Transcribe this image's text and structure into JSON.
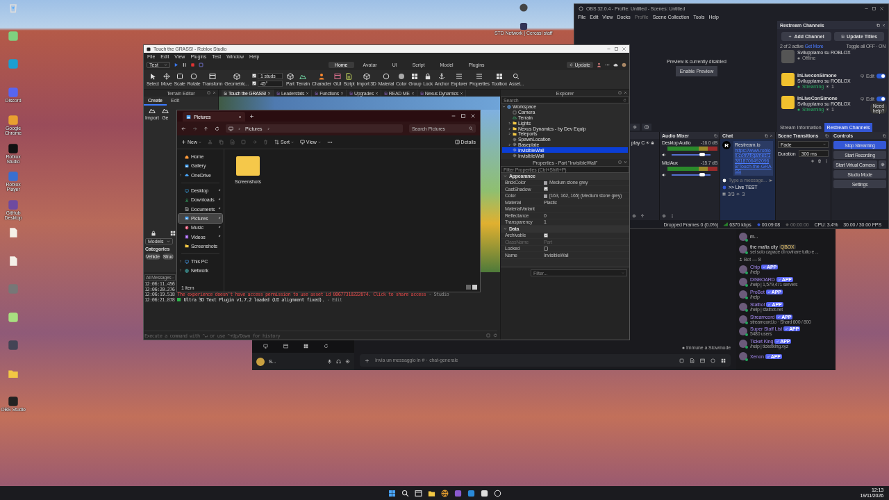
{
  "desktop": {
    "icons": [
      {
        "kind": "bin"
      },
      {
        "kind": "app"
      },
      {
        "kind": "app"
      },
      {
        "kind": "app",
        "label": "Discord"
      },
      {
        "kind": "app",
        "label": "Google Chrome"
      },
      {
        "kind": "app",
        "label": "Roblox Studio"
      },
      {
        "kind": "app",
        "label": "Roblox Player"
      },
      {
        "kind": "app",
        "label": "GitHub Desktop"
      },
      {
        "kind": "file"
      },
      {
        "kind": "file"
      },
      {
        "kind": "app"
      },
      {
        "kind": "app"
      },
      {
        "kind": "app"
      },
      {
        "kind": "folder"
      },
      {
        "kind": "app",
        "label": "OBS Studio"
      }
    ],
    "top_shortcut": {
      "label": "STD Network | Cercasi staff"
    }
  },
  "studio": {
    "title": "Touch the GRASS! - Roblox Studio",
    "menu": [
      "File",
      "Edit",
      "View",
      "Plugins",
      "Test",
      "Window",
      "Help"
    ],
    "mode": "Test",
    "ribbon_tabs": [
      {
        "label": "Home",
        "selected": true
      },
      {
        "label": "Avatar",
        "selected": false
      },
      {
        "label": "UI",
        "selected": false
      },
      {
        "label": "Script",
        "selected": false
      },
      {
        "label": "Model",
        "selected": false
      },
      {
        "label": "Plugins",
        "selected": false
      }
    ],
    "update_button": "Update",
    "tools_a": [
      "Select",
      "Move",
      "Scale",
      "Rotate",
      "Transform",
      "Geometric..."
    ],
    "snap": [
      {
        "value": "1 studs",
        "checked": true
      },
      {
        "value": "45°",
        "checked": true
      }
    ],
    "tools_b": [
      "Part",
      "Terrain",
      "Character",
      "GUI",
      "Script",
      "Import 3D",
      "Material",
      "Color",
      "Group",
      "Lock",
      "Anchor",
      "Explorer",
      "Properties",
      "Toolbox",
      "Asset..."
    ],
    "doc_tabs": [
      {
        "label": "Touch the GRASS!",
        "selected": true
      },
      {
        "label": "Leaderstats",
        "selected": false
      },
      {
        "label": "Functions",
        "selected": false
      },
      {
        "label": "Upgrades",
        "selected": false
      },
      {
        "label": "READ ME",
        "selected": false
      },
      {
        "label": "Nexus Dynamics",
        "selected": false
      }
    ],
    "terrain_editor": {
      "title": "Terrain Editor",
      "tabs": [
        {
          "label": "Create",
          "selected": true
        },
        {
          "label": "Edit",
          "selected": false
        }
      ],
      "tools": [
        "Import",
        "Ge"
      ]
    },
    "toolbox": {
      "dropdown": "Models",
      "categories_title": "Categories",
      "chips": [
        "Vehicle",
        "Struc"
      ]
    },
    "output": {
      "filter": "All Messages",
      "lines": [
        {
          "time": "12:06:11.456",
          "kind": "info"
        },
        {
          "time": "12:06:20.276",
          "kind": "info"
        },
        {
          "time": "12:06:19.518",
          "kind": "error",
          "text": "The experience doesn't have access permission to use asset id 80677318222874. Click to share access",
          "source": "-  Studio"
        },
        {
          "time": "12:06:21.878",
          "kind": "plugin",
          "text": "Ultra 3D Text Plugin v1.7.2 loaded (UI alignment fixed).",
          "source": "-  Edit"
        }
      ],
      "command_placeholder": "Execute a command with ^↵ or use ^+Up/Down for history"
    },
    "explorer": {
      "title": "Explorer",
      "search_placeholder": "Search",
      "tree": [
        {
          "label": "Workspace",
          "kind": "service",
          "expanded": true,
          "selected": false,
          "children": [
            {
              "label": "Camera",
              "kind": "camera",
              "selected": false
            },
            {
              "label": "Terrain",
              "kind": "terrain",
              "selected": false
            },
            {
              "label": "Lights",
              "kind": "folder",
              "expanded": false,
              "selected": false
            },
            {
              "label": "Nexus Dynamics - by Dev Equip",
              "kind": "folder",
              "expanded": false,
              "selected": false
            },
            {
              "label": "Teleports",
              "kind": "folder",
              "expanded": false,
              "selected": false
            },
            {
              "label": "SpawnLocation",
              "kind": "part",
              "selected": false
            },
            {
              "label": "Baseplate",
              "kind": "part",
              "expanded": false,
              "selected": false
            },
            {
              "label": "InvisibleWall",
              "kind": "part",
              "selected": true
            },
            {
              "label": "InvisibleWall",
              "kind": "part",
              "selected": false
            }
          ]
        }
      ]
    },
    "properties": {
      "title": "Properties - Part \"InvisibleWall\"",
      "filter_placeholder": "Filter Properties (Ctrl+Shift+P)",
      "sections": [
        {
          "title": "Appearance",
          "rows": [
            {
              "name": "BrickColor",
              "kind": "swatch",
              "color": "#a3a2a5",
              "value": "Medium stone grey"
            },
            {
              "name": "CastShadow",
              "kind": "check",
              "checked": true
            },
            {
              "name": "Color",
              "kind": "swatch",
              "color": "#a3a2a5",
              "value": "[163, 162, 165] (Medium stone grey)"
            },
            {
              "name": "Material",
              "kind": "text",
              "value": "Plastic"
            },
            {
              "name": "MaterialVariant",
              "kind": "text"
            },
            {
              "name": "Reflectance",
              "kind": "text",
              "value": "0"
            },
            {
              "name": "Transparency",
              "kind": "text",
              "value": "1"
            }
          ]
        },
        {
          "title": "Data",
          "rows": [
            {
              "name": "Archivable",
              "kind": "check",
              "checked": true
            },
            {
              "name": "ClassName",
              "kind": "text",
              "value": "Part",
              "disabled": true
            },
            {
              "name": "Locked",
              "kind": "check",
              "checked": false
            },
            {
              "name": "Name",
              "kind": "text",
              "value": "InvisibleWall"
            }
          ]
        }
      ]
    },
    "filter_panel": {
      "placeholder": "Filter..."
    }
  },
  "files": {
    "tab": "Pictures",
    "address": "Pictures",
    "search_placeholder": "Search Pictures",
    "toolbar": {
      "new": "New",
      "sort": "Sort",
      "view": "View",
      "details": "Details"
    },
    "sidebar": [
      [
        {
          "label": "Home",
          "selected": false,
          "pinned": false
        },
        {
          "label": "Gallery",
          "selected": false,
          "pinned": false
        },
        {
          "label": "OneDrive",
          "selected": false,
          "pinned": false,
          "expanded": false
        }
      ],
      [
        {
          "label": "Desktop",
          "selected": false,
          "pinned": true
        },
        {
          "label": "Downloads",
          "selected": false,
          "pinned": true
        },
        {
          "label": "Documents",
          "selected": false,
          "pinned": true
        },
        {
          "label": "Pictures",
          "selected": true,
          "pinned": true
        },
        {
          "label": "Music",
          "selected": false,
          "pinned": true
        },
        {
          "label": "Videos",
          "selected": false,
          "pinned": true
        },
        {
          "label": "Screenshots",
          "selected": false,
          "pinned": false
        }
      ],
      [
        {
          "label": "This PC",
          "selected": false,
          "pinned": false,
          "expanded": false
        },
        {
          "label": "Network",
          "selected": false,
          "pinned": false,
          "expanded": false
        }
      ]
    ],
    "items": [
      {
        "label": "Screenshots"
      }
    ],
    "status": "1 item"
  },
  "obs": {
    "title": "OBS 32.0.4 - Profile: Untitled - Scenes: Untitled",
    "menu": [
      {
        "label": "File",
        "disabled": false
      },
      {
        "label": "Edit",
        "disabled": false
      },
      {
        "label": "View",
        "disabled": false
      },
      {
        "label": "Docks",
        "disabled": false
      },
      {
        "label": "Profile",
        "disabled": true
      },
      {
        "label": "Scene Collection",
        "disabled": false
      },
      {
        "label": "Tools",
        "disabled": false
      },
      {
        "label": "Help",
        "disabled": false
      }
    ],
    "preview_message": "Preview is currently disabled",
    "enable_preview": "Enable Preview",
    "restream": {
      "title": "Restream Channels",
      "add_channel": "Add Channel",
      "update_titles": "Update Titles",
      "active_count": "2 of 2 active",
      "get_more": "Get More",
      "toggle_all": "Toggle all OFF · ON",
      "need_help": "Need help?",
      "channels": [
        {
          "subtitle": "Sviluppiamo su ROBLOX",
          "status": "Offline",
          "streaming": false
        },
        {
          "name": "InLiveconSimone",
          "subtitle": "Sviluppiamo su ROBLOX",
          "status": "Streaming",
          "streaming": true,
          "viewers": "1",
          "edit": "Edit",
          "on": true
        },
        {
          "name": "InLiveConSimone",
          "subtitle": "Sviluppiamo su ROBLOX",
          "status": "Streaming",
          "streaming": true,
          "viewers": "1",
          "edit": "Edit",
          "on": true
        }
      ],
      "tabs": [
        {
          "label": "Stream Information",
          "selected": false
        },
        {
          "label": "Restream Channels",
          "selected": true
        }
      ]
    },
    "sources": {
      "item": "play C"
    },
    "audio_mixer": {
      "title": "Audio Mixer",
      "channels": [
        {
          "name": "Desktop Audio",
          "reading": "-16.0 dB",
          "level": 0.78
        },
        {
          "name": "Mic/Aux",
          "reading": "-15.7 dB",
          "level": 0.78
        }
      ]
    },
    "chat": {
      "title": "Chat",
      "avatar": "R",
      "sender": "Restream.io",
      "message": "https://www.roblox.com/it/games/138187064920968/Touch-the-GRASS",
      "placeholder": "Type a message...",
      "live_title": ">> Live TEST",
      "count": "3/3",
      "viewers": "3"
    },
    "transitions": {
      "title": "Scene Transitions",
      "transition": "Fade",
      "duration_label": "Duration",
      "duration": "300 ms"
    },
    "controls": {
      "title": "Controls",
      "buttons": [
        {
          "label": "Stop Streaming",
          "active": true
        },
        {
          "label": "Start Recording",
          "active": false
        },
        {
          "label": "Start Virtual Camera",
          "active": false
        },
        {
          "label": "Studio Mode",
          "active": false
        },
        {
          "label": "Settings",
          "active": false
        }
      ]
    },
    "status_bar": {
      "dropped": "Dropped Frames 0 (0.0%)",
      "bitrate": "6370 kbps",
      "stream_time": "00:09:08",
      "record_time": "00:00:00",
      "cpu": "CPU: 3.4%",
      "fps": "30.00 / 30.00 FPS"
    }
  },
  "discord": {
    "slowmode": "Immune a Slowmode",
    "input_placeholder": "Invia un messaggio in #・chat-generale",
    "user": "S...",
    "members": [
      {
        "kind": "user",
        "name": "m..."
      },
      {
        "kind": "user",
        "name": "the mafia city",
        "tag": "QBOX",
        "sub": "sei solo capace di rovinare tutto e ..."
      },
      {
        "kind": "header",
        "name": "Bot — 8"
      },
      {
        "kind": "bot",
        "name": "Chip",
        "badge": "APP",
        "sub": "/help"
      },
      {
        "kind": "bot",
        "name": "DISBOARD",
        "badge": "APP",
        "sub": "/help | 1,579,471 servers"
      },
      {
        "kind": "bot",
        "name": "ProBot",
        "badge": "APP",
        "sub": "/help"
      },
      {
        "kind": "bot",
        "name": "Statbot",
        "badge": "APP",
        "sub": "/help | statbot.net"
      },
      {
        "kind": "bot",
        "name": "Streamcord",
        "badge": "APP",
        "sub": "streamcord.io · Shard 600 / 800"
      },
      {
        "kind": "bot",
        "name": "Super Staff List",
        "badge": "APP",
        "sub": "5480 users"
      },
      {
        "kind": "bot",
        "name": "Ticket King",
        "badge": "APP",
        "sub": "/help | ticketking.xyz"
      },
      {
        "kind": "bot",
        "name": "Xenon",
        "badge": "APP"
      }
    ]
  },
  "taskbar": {
    "time": "12:13",
    "date": "19/11/2026"
  }
}
